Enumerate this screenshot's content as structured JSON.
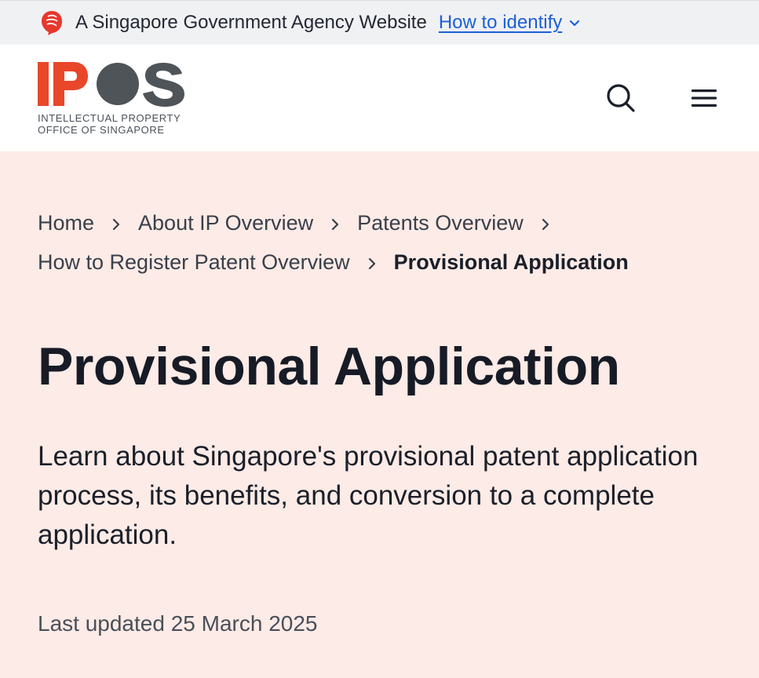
{
  "masthead": {
    "text": "A Singapore Government Agency Website",
    "identify_link": "How to identify"
  },
  "header": {
    "logo_letters": "IPOS",
    "logo_line1": "INTELLECTUAL PROPERTY",
    "logo_line2": "OFFICE OF SINGAPORE",
    "colors": {
      "brand_red": "#e8472a",
      "brand_gray": "#4f5459"
    }
  },
  "breadcrumb": {
    "items": [
      "Home",
      "About IP Overview",
      "Patents Overview",
      "How to Register Patent Overview"
    ],
    "current": "Provisional Application"
  },
  "page": {
    "title": "Provisional Application",
    "subtitle": "Learn about Singapore's provisional patent application process, its benefits, and conversion to a complete application.",
    "last_updated": "Last updated 25 March 2025"
  }
}
